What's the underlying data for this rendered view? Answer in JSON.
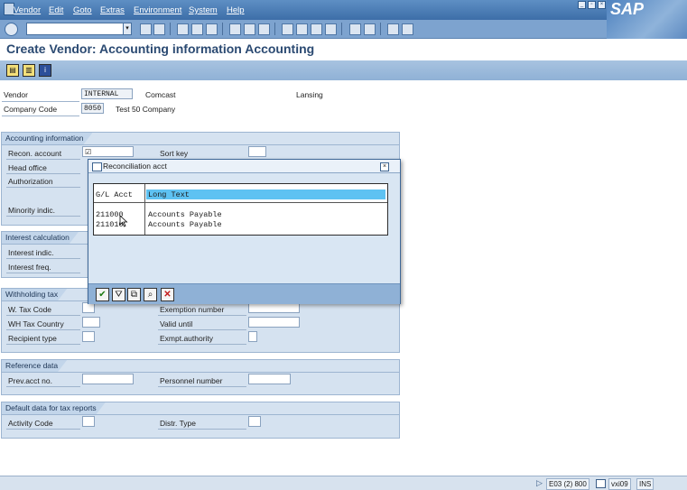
{
  "menubar": {
    "items": [
      "Vendor",
      "Edit",
      "Goto",
      "Extras",
      "Environment",
      "System",
      "Help"
    ]
  },
  "logo": "SAP",
  "page": {
    "title": "Create Vendor: Accounting information Accounting"
  },
  "header": {
    "vendor_label": "Vendor",
    "vendor_value": "INTERNAL",
    "vendor_name": "Comcast",
    "vendor_city": "Lansing",
    "company_code_label": "Company Code",
    "company_code_value": "8050",
    "company_name": "Test 50 Company"
  },
  "accounting": {
    "title": "Accounting information",
    "recon_label": "Recon. account",
    "recon_value": "☑",
    "sort_key_label": "Sort key",
    "head_office_label": "Head office",
    "authorization_label": "Authorization",
    "minority_label": "Minority indic."
  },
  "interest": {
    "title": "Interest calculation",
    "indic_label": "Interest indic.",
    "freq_label": "Interest freq."
  },
  "withholding": {
    "title": "Withholding tax",
    "tax_code_label": "W. Tax Code",
    "exemption_label": "Exemption number",
    "country_label": "WH Tax Country",
    "valid_until_label": "Valid until",
    "recipient_label": "Recipient type",
    "exmpt_auth_label": "Exmpt.authority"
  },
  "reference": {
    "title": "Reference data",
    "prev_acct_label": "Prev.acct no.",
    "personnel_label": "Personnel number"
  },
  "tax_reports": {
    "title": "Default data for tax reports",
    "activity_label": "Activity Code",
    "distr_label": "Distr. Type"
  },
  "popup": {
    "title": "Reconciliation acct",
    "col_acct": "G/L Acct",
    "col_text": "Long Text",
    "rows": [
      {
        "acct": "211000",
        "text": "Accounts Payable"
      },
      {
        "acct": "211010",
        "text": "Accounts Payable"
      }
    ]
  },
  "statusbar": {
    "system": "E03 (2) 800",
    "server": "vxi09",
    "mode": "INS"
  }
}
